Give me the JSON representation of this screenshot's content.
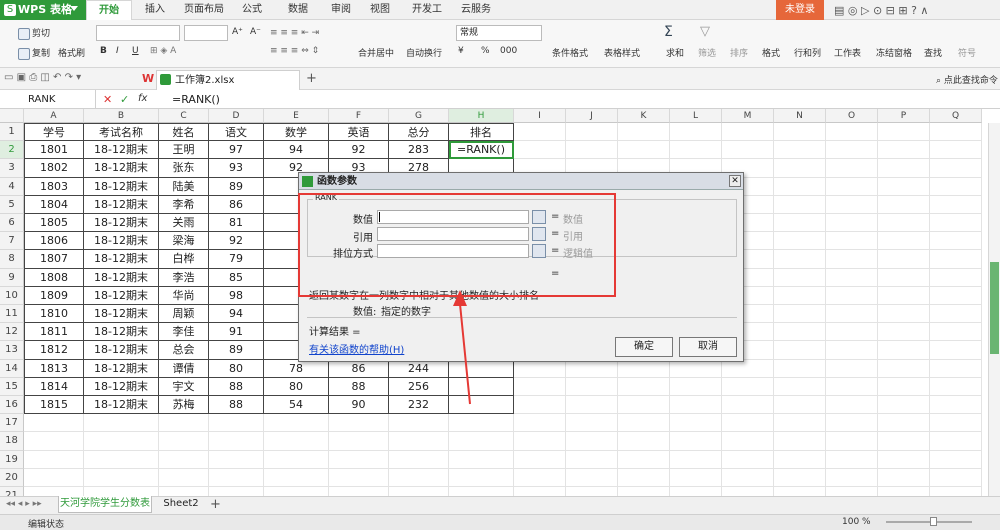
{
  "app": {
    "name": "WPS 表格",
    "logo": "S",
    "login": "未登录"
  },
  "tabs": [
    "开始",
    "插入",
    "页面布局",
    "公式",
    "数据",
    "审阅",
    "视图",
    "开发工具",
    "云服务"
  ],
  "ribbon": {
    "cut": "剪切",
    "copy": "复制",
    "painter": "格式刷",
    "bold": "B",
    "italic": "I",
    "underline": "U",
    "grow": "A⁺",
    "shrink": "A⁻",
    "merge": "合并居中",
    "wrap": "自动换行",
    "numfmt": "常规",
    "pct": "%",
    "thou": "000",
    "cond": "条件格式",
    "tblstyle": "表格样式",
    "sum": "求和",
    "filter": "筛选",
    "sort": "排序",
    "format": "格式",
    "rowcol": "行和列",
    "sheet": "工作表",
    "freeze": "冻结窗格",
    "find": "查找",
    "symbol": "符号"
  },
  "doc": {
    "tab": "工作簿2.xlsx",
    "search": "点此查找命令"
  },
  "formula": {
    "name": "RANK",
    "fx": "fx",
    "cancel": "✕",
    "ok": "✓",
    "content": "=RANK()"
  },
  "columns": [
    "A",
    "B",
    "C",
    "D",
    "E",
    "F",
    "G",
    "H",
    "I",
    "J",
    "K",
    "L",
    "M",
    "N",
    "O",
    "P",
    "Q"
  ],
  "rows": [
    "1",
    "2",
    "3",
    "4",
    "5",
    "6",
    "7",
    "8",
    "9",
    "10",
    "11",
    "12",
    "13",
    "14",
    "15",
    "16",
    "17",
    "18",
    "19",
    "20",
    "21"
  ],
  "table": {
    "headers": [
      "学号",
      "考试名称",
      "姓名",
      "语文",
      "数学",
      "英语",
      "总分",
      "排名"
    ],
    "data": [
      [
        "1801",
        "18-12期末",
        "王明",
        "97",
        "94",
        "92",
        "283",
        "=RANK()"
      ],
      [
        "1802",
        "18-12期末",
        "张东",
        "93",
        "92",
        "93",
        "278",
        ""
      ],
      [
        "1803",
        "18-12期末",
        "陆美",
        "89",
        "",
        "",
        "",
        ""
      ],
      [
        "1804",
        "18-12期末",
        "李希",
        "86",
        "",
        "",
        "",
        ""
      ],
      [
        "1805",
        "18-12期末",
        "关雨",
        "81",
        "",
        "",
        "",
        ""
      ],
      [
        "1806",
        "18-12期末",
        "梁海",
        "92",
        "",
        "",
        "",
        ""
      ],
      [
        "1807",
        "18-12期末",
        "白桦",
        "79",
        "",
        "",
        "",
        ""
      ],
      [
        "1808",
        "18-12期末",
        "李浩",
        "85",
        "",
        "",
        "",
        ""
      ],
      [
        "1809",
        "18-12期末",
        "华尚",
        "98",
        "",
        "",
        "",
        ""
      ],
      [
        "1810",
        "18-12期末",
        "周颖",
        "94",
        "",
        "",
        "",
        ""
      ],
      [
        "1811",
        "18-12期末",
        "李佳",
        "91",
        "",
        "",
        "",
        ""
      ],
      [
        "1812",
        "18-12期末",
        "总会",
        "89",
        "",
        "",
        "",
        ""
      ],
      [
        "1813",
        "18-12期末",
        "谭倩",
        "80",
        "78",
        "86",
        "244",
        ""
      ],
      [
        "1814",
        "18-12期末",
        "宇文",
        "88",
        "80",
        "88",
        "256",
        ""
      ],
      [
        "1815",
        "18-12期末",
        "苏梅",
        "88",
        "54",
        "90",
        "232",
        ""
      ]
    ]
  },
  "dialog": {
    "title": "函数参数",
    "func": "RANK",
    "args": [
      {
        "label": "数值",
        "hint": "数值"
      },
      {
        "label": "引用",
        "hint": "引用"
      },
      {
        "label": "排位方式",
        "hint": "逻辑值"
      }
    ],
    "eq": "=",
    "desc": "返回某数字在一列数字中相对于其他数值的大小排名",
    "argdesc_label": "数值:",
    "argdesc": "指定的数字",
    "result": "计算结果 =",
    "help": "有关该函数的帮助(H)",
    "ok": "确定",
    "cancel": "取消"
  },
  "sheets": [
    "天河学院学生分数表",
    "Sheet2"
  ],
  "status": {
    "mode": "编辑状态",
    "zoom": "100 %"
  },
  "colors": {
    "brand": "#2f9a3a",
    "highlight": "#e53935",
    "login": "#e6673a"
  }
}
